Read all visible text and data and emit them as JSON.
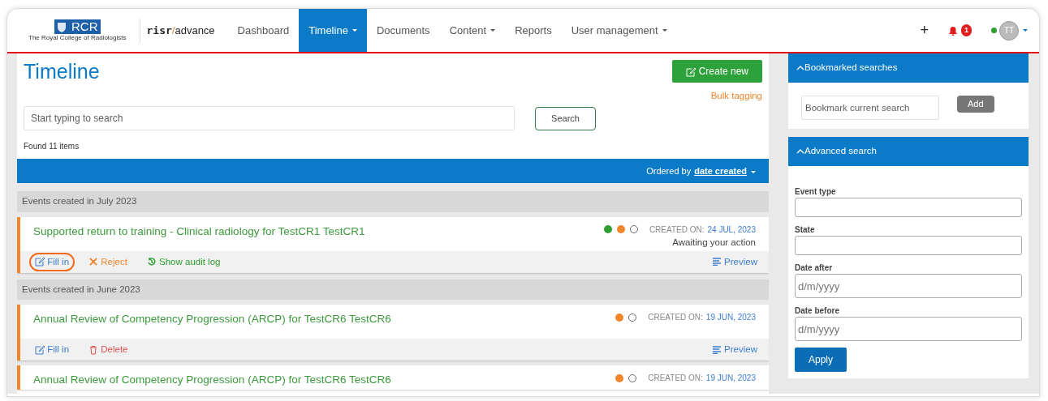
{
  "brand": {
    "logo": "RCR",
    "logo_subtitle": "The Royal College of Radiologists",
    "product_prefix": "risr",
    "product_slash": "/",
    "product_name": "advance"
  },
  "nav": [
    {
      "label": "Dashboard",
      "selected": false,
      "dropdown": false
    },
    {
      "label": "Timeline",
      "selected": true,
      "dropdown": true
    },
    {
      "label": "Documents",
      "selected": false,
      "dropdown": false
    },
    {
      "label": "Content",
      "selected": false,
      "dropdown": true
    },
    {
      "label": "Reports",
      "selected": false,
      "dropdown": false
    },
    {
      "label": "User management",
      "selected": false,
      "dropdown": true
    }
  ],
  "nav_right": {
    "add": "+",
    "notifications": "1",
    "user_initials": "TT",
    "online": true
  },
  "page": {
    "title": "Timeline",
    "create_button": "Create new",
    "bulk_link": "Bulk tagging",
    "search_placeholder": "Start typing to search",
    "search_button": "Search",
    "found": "Found 11 items",
    "order_label": "Ordered by",
    "order_value": "date created"
  },
  "groups": [
    {
      "header": "Events created in July 2023",
      "events": [
        {
          "title": "Supported return to training - Clinical radiology for TestCR1 TestCR1",
          "dots": [
            {
              "kind": "filled",
              "color": "#2e9e2e"
            },
            {
              "kind": "filled",
              "color": "#f0862e"
            },
            {
              "kind": "outline",
              "color": "#666666"
            }
          ],
          "created_label": "CREATED ON:",
          "created_date": "24 JUL, 2023",
          "status": "Awaiting your action",
          "actions": [
            {
              "kind": "edit",
              "label": "Fill in",
              "highlighted": true
            },
            {
              "kind": "reject",
              "label": "Reject",
              "highlighted": false
            },
            {
              "kind": "audit",
              "label": "Show audit log",
              "highlighted": false
            }
          ],
          "preview": "Preview"
        }
      ]
    },
    {
      "header": "Events created in June 2023",
      "events": [
        {
          "title": "Annual Review of Competency Progression (ARCP) for TestCR6 TestCR6",
          "dots": [
            {
              "kind": "filled",
              "color": "#f0862e"
            },
            {
              "kind": "outline",
              "color": "#666666"
            }
          ],
          "created_label": "CREATED ON:",
          "created_date": "19 JUN, 2023",
          "actions": [
            {
              "kind": "edit",
              "label": "Fill in",
              "highlighted": false
            },
            {
              "kind": "delete",
              "label": "Delete",
              "highlighted": false
            }
          ],
          "preview": "Preview"
        },
        {
          "title": "Annual Review of Competency Progression (ARCP) for TestCR6 TestCR6",
          "dots": [
            {
              "kind": "filled",
              "color": "#f0862e"
            },
            {
              "kind": "outline",
              "color": "#666666"
            }
          ],
          "created_label": "CREATED ON:",
          "created_date": "19 JUN, 2023"
        }
      ]
    }
  ],
  "sidebar": {
    "bookmarks": {
      "title": "Bookmarked searches",
      "placeholder": "Bookmark current search",
      "button": "Add"
    },
    "advanced": {
      "title": "Advanced search",
      "fields": [
        {
          "label": "Event type"
        },
        {
          "label": "State"
        },
        {
          "label": "Date after",
          "placeholder": "d/m/yyyy"
        },
        {
          "label": "Date before",
          "placeholder": "d/m/yyyy"
        }
      ],
      "button": "Apply"
    }
  }
}
